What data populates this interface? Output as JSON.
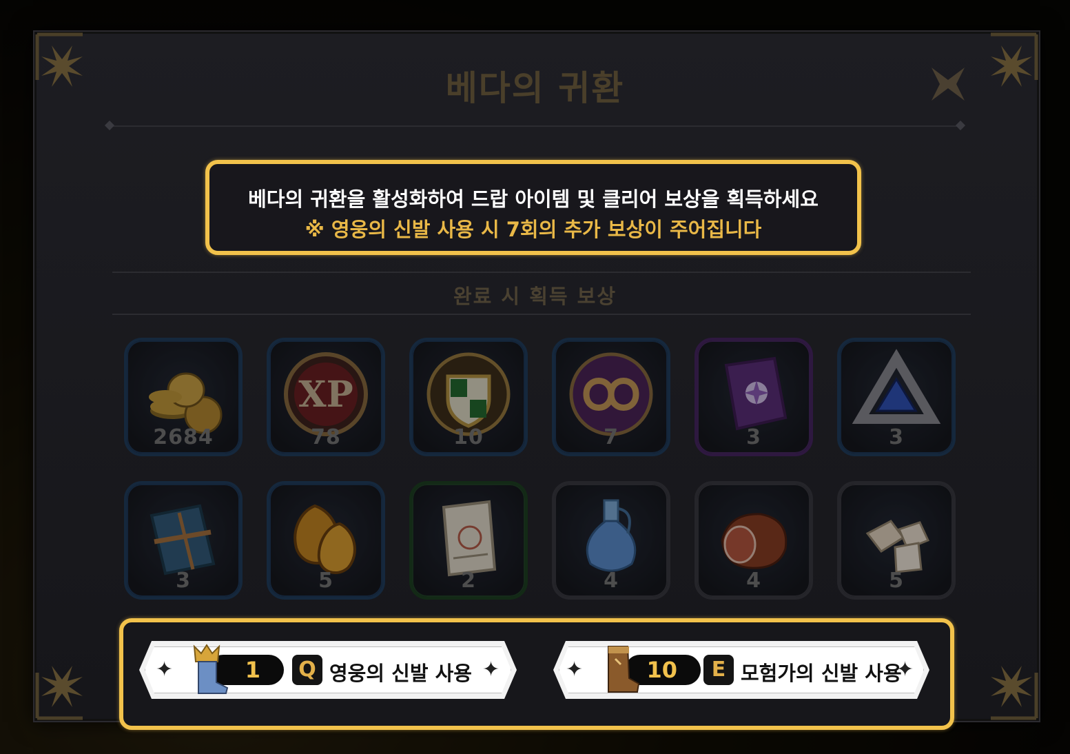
{
  "title": "베다의 귀환",
  "banner": {
    "line1": "베다의 귀환을 활성화하여 드랍 아이템 및 클리어 보상을 획득하세요",
    "line2": "※ 영웅의 신발 사용 시 7회의 추가 보상이 주어집니다"
  },
  "section_title": "완료 시 획득 보상",
  "rewards": [
    {
      "icon": "gold-coins-icon",
      "count": "2684",
      "rarity": "blue"
    },
    {
      "icon": "xp-medal-icon",
      "count": "78",
      "rarity": "blue"
    },
    {
      "icon": "guild-crest-icon",
      "count": "10",
      "rarity": "blue"
    },
    {
      "icon": "infinity-emblem-icon",
      "count": "7",
      "rarity": "blue"
    },
    {
      "icon": "purple-tome-icon",
      "count": "3",
      "rarity": "purple"
    },
    {
      "icon": "triangle-gem-icon",
      "count": "3",
      "rarity": "blue"
    },
    {
      "icon": "blue-book-icon",
      "count": "3",
      "rarity": "blue"
    },
    {
      "icon": "amber-stone-icon",
      "count": "5",
      "rarity": "blue"
    },
    {
      "icon": "scroll-card-icon",
      "count": "2",
      "rarity": "green"
    },
    {
      "icon": "water-flask-icon",
      "count": "4",
      "rarity": "gray"
    },
    {
      "icon": "raw-meat-icon",
      "count": "4",
      "rarity": "gray"
    },
    {
      "icon": "salt-crystal-icon",
      "count": "5",
      "rarity": "gray"
    }
  ],
  "buttons": {
    "hero": {
      "count": "1",
      "key": "Q",
      "label": "영웅의 신발 사용",
      "icon": "hero-boots-icon"
    },
    "adventurer": {
      "count": "10",
      "key": "E",
      "label": "모험가의 신발 사용",
      "icon": "adventurer-boots-icon"
    }
  },
  "colors": {
    "highlight": "#f2c24b",
    "accent_text": "#e9b847",
    "panel": "#1b1b20"
  }
}
